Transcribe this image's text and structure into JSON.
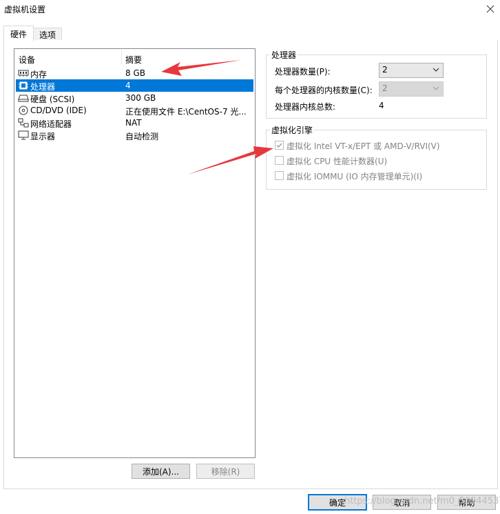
{
  "window": {
    "title": "虚拟机设置",
    "close_icon": "close-icon"
  },
  "tabs": [
    {
      "label": "硬件",
      "active": true
    },
    {
      "label": "选项",
      "active": false
    }
  ],
  "device_list": {
    "columns": {
      "device": "设备",
      "summary": "摘要"
    },
    "rows": [
      {
        "icon": "memory-icon",
        "name": "内存",
        "summary": "8 GB",
        "selected": false
      },
      {
        "icon": "processor-icon",
        "name": "处理器",
        "summary": "4",
        "selected": true
      },
      {
        "icon": "hard-disk-icon",
        "name": "硬盘 (SCSI)",
        "summary": "300 GB",
        "selected": false
      },
      {
        "icon": "cd-dvd-icon",
        "name": "CD/DVD (IDE)",
        "summary": "正在使用文件 E:\\CentOS-7 光...",
        "selected": false
      },
      {
        "icon": "network-adapter-icon",
        "name": "网络适配器",
        "summary": "NAT",
        "selected": false
      },
      {
        "icon": "display-icon",
        "name": "显示器",
        "summary": "自动检测",
        "selected": false
      }
    ]
  },
  "buttons": {
    "add": "添加(A)...",
    "remove": "移除(R)",
    "ok": "确定",
    "cancel": "取消",
    "help": "帮助"
  },
  "processor_group": {
    "title": "处理器",
    "count_label": "处理器数量(P):",
    "count_value": "2",
    "cores_label": "每个处理器的内核数量(C):",
    "cores_value": "2",
    "total_label": "处理器内核总数:",
    "total_value": "4"
  },
  "virtualization_group": {
    "title": "虚拟化引擎",
    "options": [
      {
        "label": "虚拟化 Intel VT-x/EPT 或 AMD-V/RVI(V)",
        "checked": true,
        "enabled": false
      },
      {
        "label": "虚拟化 CPU 性能计数器(U)",
        "checked": false,
        "enabled": false
      },
      {
        "label": "虚拟化 IOMMU (IO 内存管理单元)(I)",
        "checked": false,
        "enabled": false
      }
    ]
  },
  "annotations": {
    "arrow_color": "#e8373e"
  },
  "watermark": "https://blog.csdn.net/m0_50944537"
}
